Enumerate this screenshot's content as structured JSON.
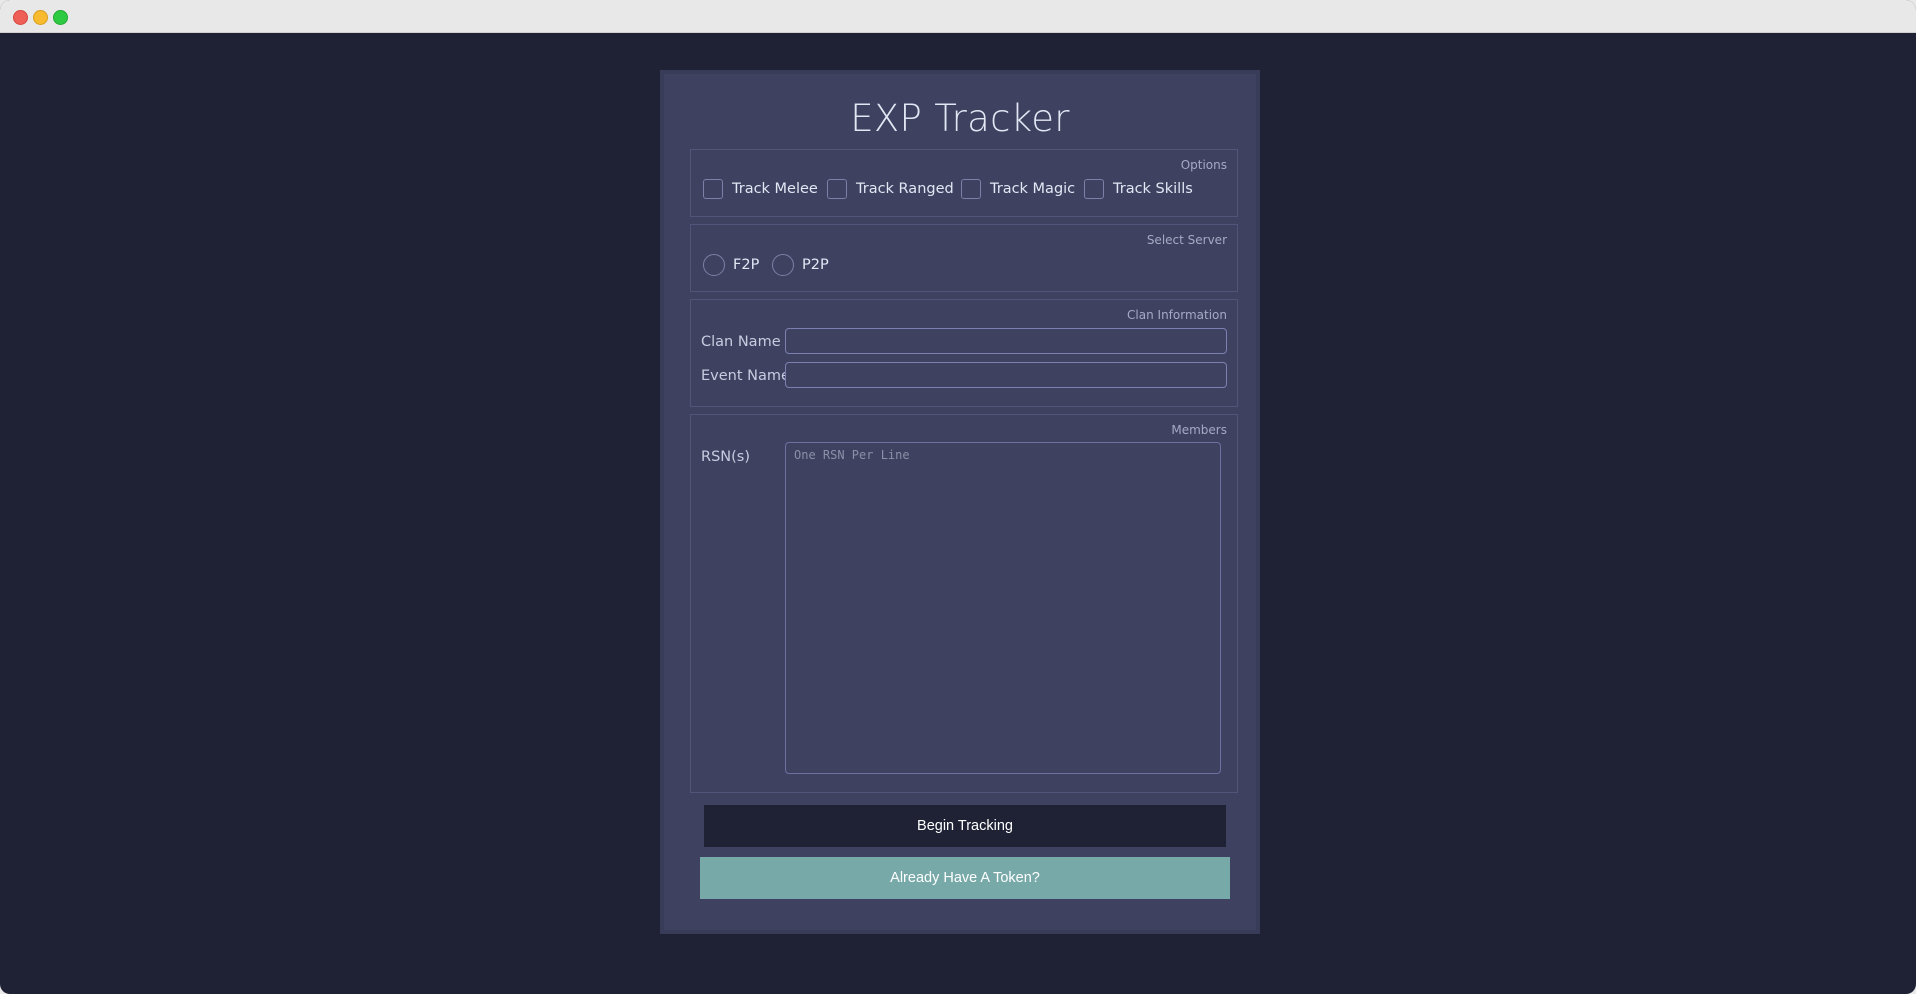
{
  "app": {
    "title": "EXP Tracker"
  },
  "options": {
    "legend": "Options",
    "items": [
      {
        "label": "Track Melee",
        "checked": false
      },
      {
        "label": "Track Ranged",
        "checked": false
      },
      {
        "label": "Track Magic",
        "checked": false
      },
      {
        "label": "Track Skills",
        "checked": false
      }
    ]
  },
  "server": {
    "legend": "Select Server",
    "items": [
      {
        "label": "F2P",
        "selected": false
      },
      {
        "label": "P2P",
        "selected": false
      }
    ]
  },
  "clan": {
    "legend": "Clan Information",
    "clan_name_label": "Clan Name",
    "clan_name_value": "",
    "event_name_label": "Event Name",
    "event_name_value": ""
  },
  "members": {
    "legend": "Members",
    "rsn_label": "RSN(s)",
    "rsn_placeholder": "One RSN Per Line",
    "rsn_value": ""
  },
  "buttons": {
    "begin_tracking": "Begin Tracking",
    "token": "Already Have A Token?"
  },
  "colors": {
    "background": "#1f2235",
    "panel": "#3e4260",
    "begin_button": "#1f2235",
    "token_button": "#78a9a9",
    "text": "#e3e6f3"
  }
}
